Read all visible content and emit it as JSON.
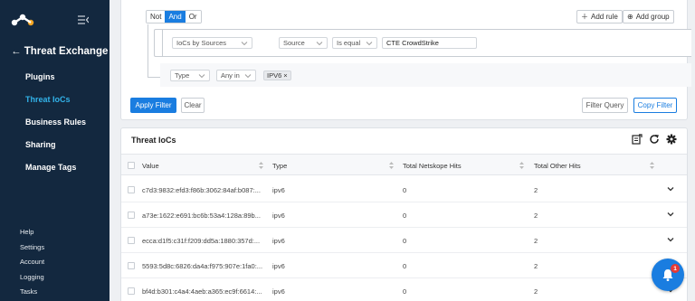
{
  "sidebar": {
    "section_title": "Threat Exchange",
    "nav_items": [
      {
        "label": "Plugins"
      },
      {
        "label": "Threat IoCs"
      },
      {
        "label": "Business Rules"
      },
      {
        "label": "Sharing"
      },
      {
        "label": "Manage Tags"
      }
    ],
    "bottom_links": [
      {
        "label": "Help"
      },
      {
        "label": "Settings"
      },
      {
        "label": "Account"
      },
      {
        "label": "Logging"
      },
      {
        "label": "Tasks"
      }
    ]
  },
  "filter": {
    "logic": {
      "not": "Not",
      "and": "And",
      "or": "Or",
      "selected": "And"
    },
    "add_rule": "Add rule",
    "add_group": "Add group",
    "rule1": {
      "group_field": "IoCs by Sources",
      "field": "Source",
      "operator": "Is equal",
      "value": "CTE CrowdStrike"
    },
    "rule2": {
      "field": "Type",
      "operator": "Any in",
      "tag": "IPV6"
    },
    "apply_filter": "Apply Filter",
    "clear": "Clear",
    "filter_query": "Filter Query",
    "copy_filter": "Copy Filter"
  },
  "table": {
    "title": "Threat IoCs",
    "columns": [
      "Value",
      "Type",
      "Total Netskope Hits",
      "Total Other Hits"
    ],
    "rows": [
      {
        "value": "c7d3:9832:efd3:f86b:3062:84af:b087:...",
        "type": "ipv6",
        "netskope_hits": "0",
        "other_hits": "2"
      },
      {
        "value": "a73e:1622:e691:bc6b:53a4:128a:89b...",
        "type": "ipv6",
        "netskope_hits": "0",
        "other_hits": "2"
      },
      {
        "value": "ecca:d1f5:c31f:f209:dd5a:1880:357d:...",
        "type": "ipv6",
        "netskope_hits": "0",
        "other_hits": "2"
      },
      {
        "value": "5593:5d8c:6826:da4a:f975:907e:1fa0:...",
        "type": "ipv6",
        "netskope_hits": "0",
        "other_hits": "2"
      },
      {
        "value": "bf4d:b301:c4a4:4aeb:a365:ec9f:6614:...",
        "type": "ipv6",
        "netskope_hits": "0",
        "other_hits": "2"
      }
    ]
  },
  "notification": {
    "badge": "1"
  },
  "colors": {
    "sidebar_bg": "#13283f",
    "accent": "#1a7de0",
    "active_nav": "#32b3ea",
    "badge": "#e53935"
  }
}
